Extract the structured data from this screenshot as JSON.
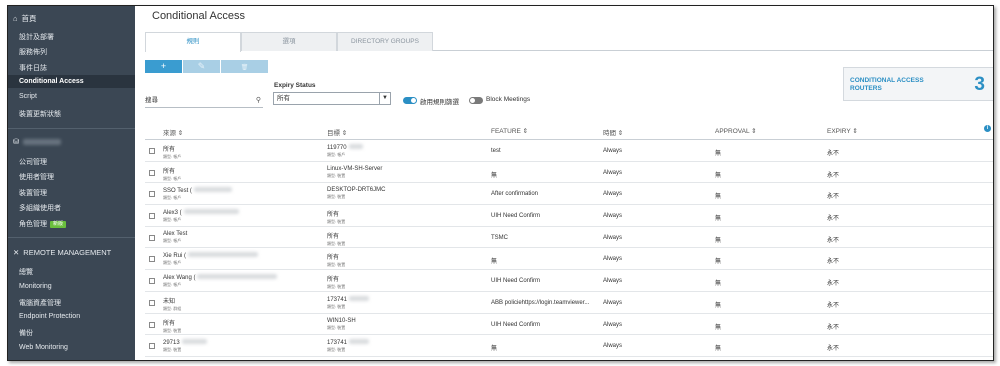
{
  "sidebar": {
    "home": "首頁",
    "items_top": [
      "設計及部署",
      "服務佈列",
      "事件日誌",
      "Conditional Access",
      "Script",
      "裝置更新狀態"
    ],
    "active_index": 3,
    "company_items": [
      "公司管理",
      "使用者管理",
      "裝置管理",
      "多組織使用者",
      "角色管理"
    ],
    "role_badge": "新版",
    "remote_header": "REMOTE MANAGEMENT",
    "remote_items": [
      "總覽",
      "Monitoring",
      "電腦資產管理",
      "Endpoint Protection",
      "備份",
      "Web Monitoring"
    ]
  },
  "page": {
    "title": "Conditional Access",
    "tabs": [
      "規則",
      "選項",
      "DIRECTORY GROUPS"
    ],
    "active_tab": 0
  },
  "toolbar": {
    "add": "+",
    "edit": "✎",
    "delete": "🗑"
  },
  "filters": {
    "search_placeholder": "搜尋",
    "expiry_label": "Expiry Status",
    "expiry_value": "所有",
    "toggle_enabled_label": "啟用規則篩選",
    "toggle_block_label": "Block Meetings"
  },
  "routers": {
    "label_line1": "CONDITIONAL ACCESS",
    "label_line2": "ROUTERS",
    "count": "3"
  },
  "table": {
    "headers": [
      "來源",
      "目標",
      "FEATURE",
      "時間",
      "APPROVAL",
      "EXPIRY"
    ],
    "rows": [
      {
        "source": "所有",
        "source_type": "類型: 帳戶",
        "target": "119770",
        "target_type": "類型: 帳戶",
        "feature": "test",
        "time": "Always",
        "approval": "無",
        "expiry": "永不"
      },
      {
        "source": "所有",
        "source_type": "類型: 帳戶",
        "target": "Linux-VM-SH-Server",
        "target_type": "類型: 裝置",
        "feature": "無",
        "time": "Always",
        "approval": "無",
        "expiry": "永不"
      },
      {
        "source": "SSO Test (",
        "source_type": "類型: 帳戶",
        "target": "DESKTOP-DRT6JMC",
        "target_type": "類型: 裝置",
        "feature": "After confirmation",
        "time": "Always",
        "approval": "無",
        "expiry": "永不"
      },
      {
        "source": "Alex3 (",
        "source_type": "類型: 帳戶",
        "target": "所有",
        "target_type": "類型: 裝置",
        "feature": "UIH Need Confirm",
        "time": "Always",
        "approval": "無",
        "expiry": "永不"
      },
      {
        "source": "Alex Test",
        "source_type": "類型: 帳戶",
        "target": "所有",
        "target_type": "類型: 裝置",
        "feature": "TSMC",
        "time": "Always",
        "approval": "無",
        "expiry": "永不"
      },
      {
        "source": "Xie Rui (",
        "source_type": "類型: 帳戶",
        "target": "所有",
        "target_type": "類型: 裝置",
        "feature": "無",
        "time": "Always",
        "approval": "無",
        "expiry": "永不"
      },
      {
        "source": "Alex Wang (",
        "source_type": "類型: 帳戶",
        "target": "所有",
        "target_type": "類型: 裝置",
        "feature": "UIH Need Confirm",
        "time": "Always",
        "approval": "無",
        "expiry": "永不"
      },
      {
        "source": "未知",
        "source_type": "類型: 群組",
        "target": "173741",
        "target_type": "類型: 裝置",
        "feature": "ABB policiehttps://login.teamviewer...",
        "time": "Always",
        "approval": "無",
        "expiry": "永不"
      },
      {
        "source": "所有",
        "source_type": "類型: 裝置",
        "target": "WIN10-SH",
        "target_type": "類型: 裝置",
        "feature": "UIH Need Confirm",
        "time": "Always",
        "approval": "無",
        "expiry": "永不"
      },
      {
        "source": "29713",
        "source_type": "類型: 裝置",
        "target": "173741",
        "target_type": "類型: 裝置",
        "feature": "無",
        "time": "Always",
        "approval": "無",
        "expiry": "永不"
      }
    ]
  },
  "colors": {
    "sidebar_bg": "#3b4754",
    "accent": "#2b8fc4",
    "button": "#3a9cd0",
    "badge": "#6abf3d"
  }
}
